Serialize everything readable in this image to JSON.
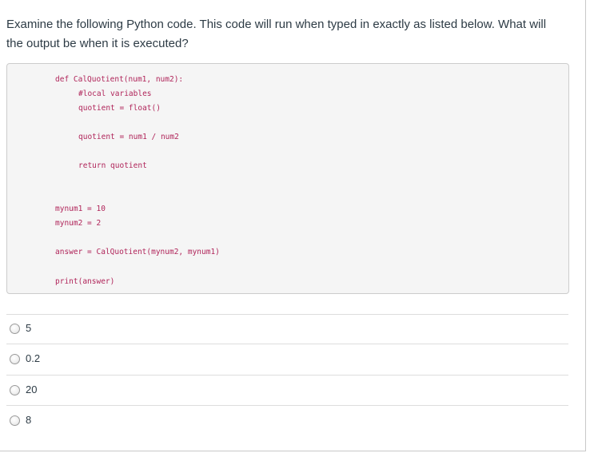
{
  "question": {
    "text": "Examine the following Python code. This code will run when typed in exactly as listed below. What will the output be when it is executed?"
  },
  "code": {
    "lines": [
      "def CalQuotient(num1, num2):",
      "#local variables",
      "quotient = float()",
      "quotient = num1 / num2",
      "return quotient",
      "mynum1 = 10",
      "mynum2 = 2",
      "answer = CalQuotient(mynum2, mynum1)",
      "print(answer)"
    ]
  },
  "answers": [
    {
      "label": "5"
    },
    {
      "label": "0.2"
    },
    {
      "label": "20"
    },
    {
      "label": "8"
    }
  ]
}
